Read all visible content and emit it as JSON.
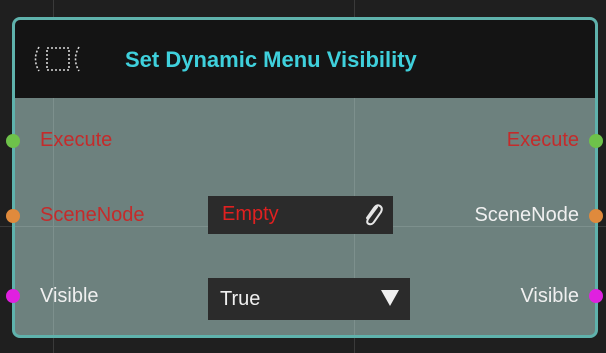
{
  "node": {
    "title": "Set Dynamic Menu Visibility",
    "icon": "node-type-icon",
    "accent_color": "#3fd0dc",
    "border_color": "#5fb2ac"
  },
  "inputs": {
    "execute": {
      "label": "Execute",
      "pin_color": "#6ec24a"
    },
    "scenenode": {
      "label": "SceneNode",
      "pin_color": "#e08a3c"
    },
    "visible": {
      "label": "Visible",
      "pin_color": "#e020e0"
    }
  },
  "outputs": {
    "execute": {
      "label": "Execute",
      "pin_color": "#6ec24a"
    },
    "scenenode": {
      "label": "SceneNode",
      "pin_color": "#e08a3c"
    },
    "visible": {
      "label": "Visible",
      "pin_color": "#e020e0"
    }
  },
  "fields": {
    "scenenode_value": {
      "value": "Empty",
      "icon": "paperclip-icon"
    },
    "visible_value": {
      "value": "True",
      "icon": "dropdown-caret-icon"
    }
  }
}
